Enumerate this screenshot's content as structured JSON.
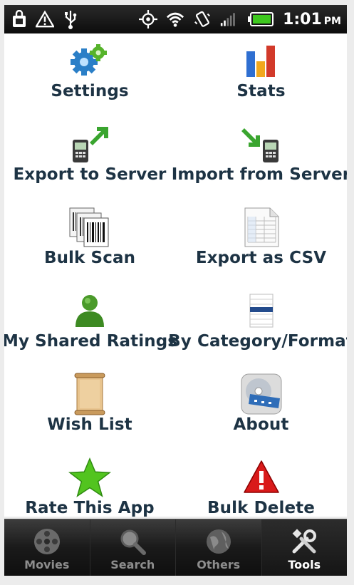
{
  "status_bar": {
    "time": "1:01",
    "ampm": "PM",
    "icons": [
      "bag-icon",
      "warning-icon",
      "usb-icon",
      "gps-icon",
      "wifi-icon",
      "vibrate-icon",
      "signal-icon",
      "battery-icon"
    ]
  },
  "menu": {
    "items": [
      {
        "label": "Settings",
        "icon": "gears-icon"
      },
      {
        "label": "Stats",
        "icon": "bar-chart-icon"
      },
      {
        "label": "Export to Server",
        "icon": "phone-export-icon"
      },
      {
        "label": "Import from Server",
        "icon": "phone-import-icon"
      },
      {
        "label": "Bulk Scan",
        "icon": "barcode-stack-icon"
      },
      {
        "label": "Export as CSV",
        "icon": "spreadsheet-icon"
      },
      {
        "label": "My Shared Ratings",
        "icon": "user-icon"
      },
      {
        "label": "By Category/Format",
        "icon": "list-icon"
      },
      {
        "label": "Wish List",
        "icon": "scroll-icon"
      },
      {
        "label": "About",
        "icon": "disc-icon"
      },
      {
        "label": "Rate This App",
        "icon": "star-icon"
      },
      {
        "label": "Bulk Delete",
        "icon": "alert-icon"
      }
    ]
  },
  "tabs": [
    {
      "label": "Movies",
      "icon": "film-reel-icon",
      "active": false
    },
    {
      "label": "Search",
      "icon": "magnifier-icon",
      "active": false
    },
    {
      "label": "Others",
      "icon": "globe-icon",
      "active": false
    },
    {
      "label": "Tools",
      "icon": "tools-icon",
      "active": true
    }
  ],
  "colors": {
    "label_text": "#1d3344",
    "tab_active": "#ffffff",
    "tab_inactive": "#8d8d8d"
  }
}
